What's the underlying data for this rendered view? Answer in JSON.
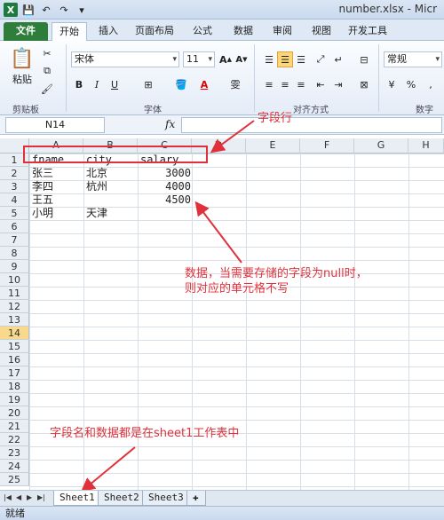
{
  "window": {
    "title": "number.xlsx - Micr"
  },
  "ribbon_tabs": [
    "文件",
    "开始",
    "插入",
    "页面布局",
    "公式",
    "数据",
    "审阅",
    "视图",
    "开发工具"
  ],
  "ribbon": {
    "clipboard": {
      "paste_label": "粘贴",
      "group_label": "剪贴板"
    },
    "font": {
      "font_name": "宋体",
      "font_size": "11",
      "group_label": "字体"
    },
    "alignment": {
      "group_label": "对齐方式"
    },
    "number": {
      "format": "常规",
      "group_label": "数字"
    },
    "accent_color": "#2f7d3a"
  },
  "formula_bar": {
    "name_box": "N14",
    "fx_label": "fx",
    "formula": ""
  },
  "sheet": {
    "columns": [
      "A",
      "B",
      "C",
      "D",
      "E",
      "F",
      "G",
      "H"
    ],
    "rows": [
      "1",
      "2",
      "3",
      "4",
      "5",
      "6",
      "7",
      "8",
      "9",
      "10",
      "11",
      "12",
      "13",
      "14",
      "15",
      "16",
      "17",
      "18",
      "19",
      "20",
      "21",
      "22",
      "23",
      "24",
      "25"
    ],
    "selected_row": "14",
    "cells": {
      "A1": "fname",
      "B1": "city",
      "C1": "salary",
      "A2": "张三",
      "B2": "北京",
      "C2": "3000",
      "A3": "李四",
      "B3": "杭州",
      "C3": "4000",
      "A4": "王五",
      "C4": "4500",
      "A5": "小明",
      "B5": "天津"
    }
  },
  "annotations": {
    "field_row": "字段行",
    "data_note_line1": "数据，当需要存储的字段为null时，",
    "data_note_line2": "则对应的单元格不写",
    "sheet_note": "字段名和数据都是在sheet1工作表中",
    "color": "#e0313a"
  },
  "sheet_tabs": [
    "Sheet1",
    "Sheet2",
    "Sheet3"
  ],
  "status": {
    "text": "就绪"
  }
}
